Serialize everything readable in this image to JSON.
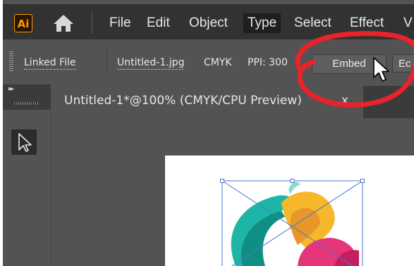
{
  "menubar": {
    "logo": "Ai",
    "home_icon": "home-icon",
    "items": [
      {
        "label": "File"
      },
      {
        "label": "Edit"
      },
      {
        "label": "Object"
      },
      {
        "label": "Type",
        "active": true
      },
      {
        "label": "Select"
      },
      {
        "label": "Effect"
      },
      {
        "label": "V"
      }
    ]
  },
  "controlbar": {
    "linked_file_label": "Linked File",
    "filename": "Untitled-1.jpg",
    "color_mode": "CMYK",
    "ppi": "PPI: 300",
    "embed_label": "Embed",
    "edit_label_partial": "Ec"
  },
  "tools": {
    "collapse_glyph": "▸▸"
  },
  "document": {
    "tab_title": "Untitled-1*@100% (CMYK/CPU Preview)",
    "tab_close": "x"
  },
  "colors": {
    "annotation_red": "#e8232a",
    "selection_blue": "#4a7ac9",
    "menubar_bg": "#323232",
    "panel_bg": "#535353"
  }
}
